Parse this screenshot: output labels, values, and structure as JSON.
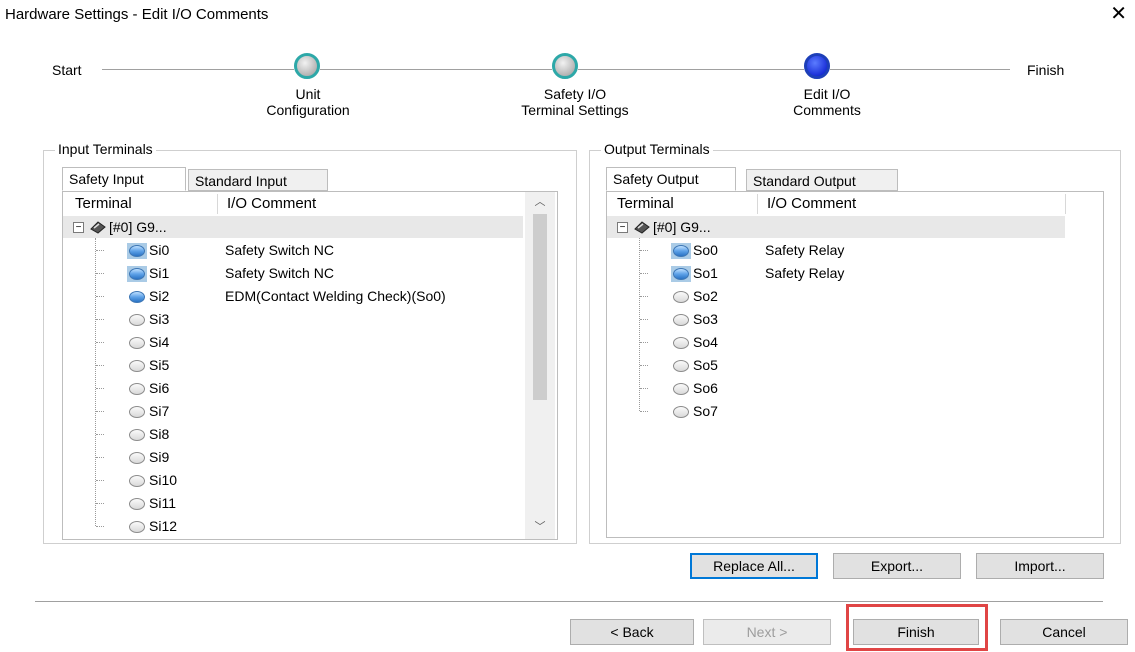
{
  "window": {
    "title": "Hardware Settings - Edit I/O Comments",
    "close_glyph": "✕"
  },
  "wizard": {
    "start": "Start",
    "finish": "Finish",
    "steps": [
      {
        "line1": "Unit",
        "line2": "Configuration",
        "state": "done"
      },
      {
        "line1": "Safety I/O",
        "line2": "Terminal Settings",
        "state": "done"
      },
      {
        "line1": "Edit I/O",
        "line2": "Comments",
        "state": "active"
      }
    ]
  },
  "input_panel": {
    "legend": "Input Terminals",
    "tabs": [
      "Safety Input",
      "Standard Input"
    ],
    "selected_tab": "Safety Input",
    "columns": [
      "Terminal",
      "I/O Comment"
    ],
    "root": "[#0] G9...",
    "rows": [
      {
        "terminal": "Si0",
        "comment": "Safety Switch NC",
        "state": "on-box"
      },
      {
        "terminal": "Si1",
        "comment": "Safety Switch NC",
        "state": "on-box"
      },
      {
        "terminal": "Si2",
        "comment": "EDM(Contact Welding Check)(So0)",
        "state": "on"
      },
      {
        "terminal": "Si3",
        "comment": "",
        "state": "off"
      },
      {
        "terminal": "Si4",
        "comment": "",
        "state": "off"
      },
      {
        "terminal": "Si5",
        "comment": "",
        "state": "off"
      },
      {
        "terminal": "Si6",
        "comment": "",
        "state": "off"
      },
      {
        "terminal": "Si7",
        "comment": "",
        "state": "off"
      },
      {
        "terminal": "Si8",
        "comment": "",
        "state": "off"
      },
      {
        "terminal": "Si9",
        "comment": "",
        "state": "off"
      },
      {
        "terminal": "Si10",
        "comment": "",
        "state": "off"
      },
      {
        "terminal": "Si11",
        "comment": "",
        "state": "off"
      },
      {
        "terminal": "Si12",
        "comment": "",
        "state": "off"
      }
    ]
  },
  "output_panel": {
    "legend": "Output Terminals",
    "tabs": [
      "Safety Output",
      "Standard Output"
    ],
    "selected_tab": "Safety Output",
    "columns": [
      "Terminal",
      "I/O Comment"
    ],
    "root": "[#0] G9...",
    "rows": [
      {
        "terminal": "So0",
        "comment": "Safety Relay",
        "state": "on-box"
      },
      {
        "terminal": "So1",
        "comment": "Safety Relay",
        "state": "on-box"
      },
      {
        "terminal": "So2",
        "comment": "",
        "state": "off"
      },
      {
        "terminal": "So3",
        "comment": "",
        "state": "off"
      },
      {
        "terminal": "So4",
        "comment": "",
        "state": "off"
      },
      {
        "terminal": "So5",
        "comment": "",
        "state": "off"
      },
      {
        "terminal": "So6",
        "comment": "",
        "state": "off"
      },
      {
        "terminal": "So7",
        "comment": "",
        "state": "off"
      }
    ]
  },
  "actions": {
    "replace_all": "Replace All...",
    "export": "Export...",
    "import": "Import..."
  },
  "nav": {
    "back": "< Back",
    "next": "Next >",
    "finish": "Finish",
    "cancel": "Cancel"
  },
  "colors": {
    "focus_border": "#0078d7",
    "highlight": "#e04545",
    "active_step": "#0010c8",
    "done_step_ring": "#2da8a8"
  }
}
